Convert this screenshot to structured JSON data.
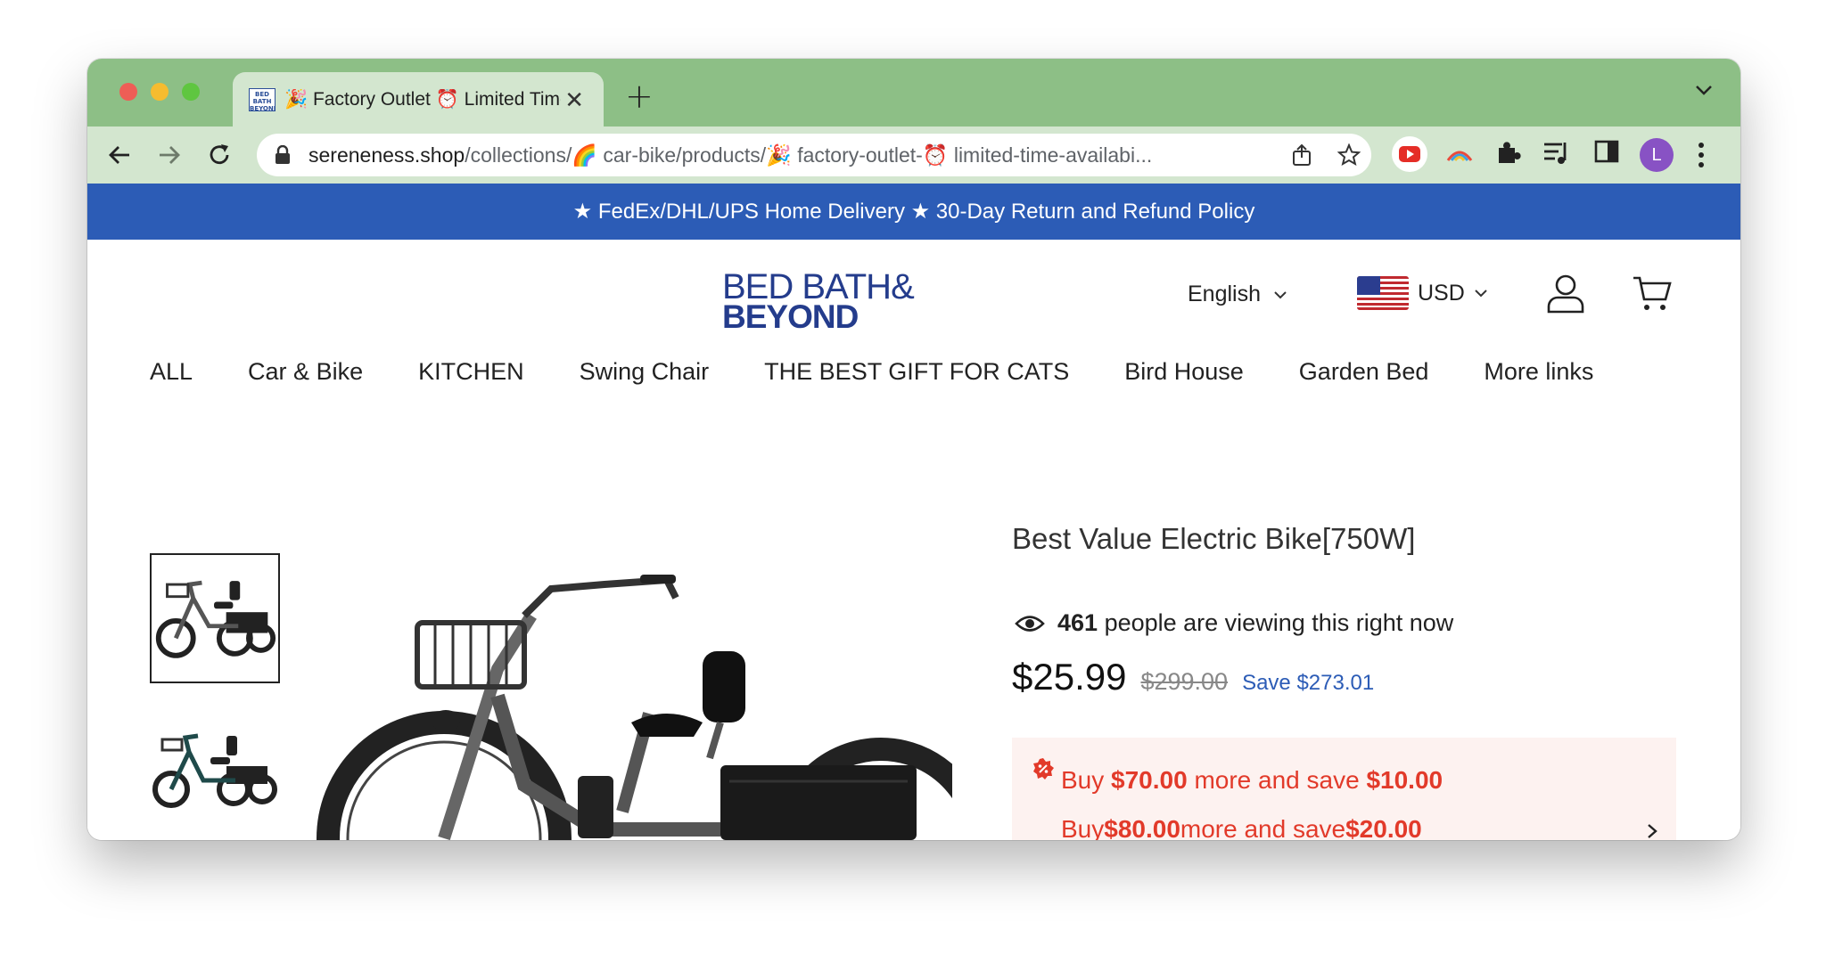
{
  "browser": {
    "tab_title": "🎉 Factory Outlet ⏰ Limited Time Availability",
    "tab_favicon_text": "BED BATH BEYOND",
    "url_host": "sereneness.shop",
    "url_path": "/collections/🌈 car-bike/products/🎉 factory-outlet-⏰ limited-time-availabi...",
    "profile_initial": "L",
    "accent_color": "#8dbf86"
  },
  "announcement": "★ FedEx/DHL/UPS Home Delivery ★ 30-Day Return and Refund Policy",
  "header": {
    "logo_line1": "BED BATH&",
    "logo_line2": "BEYOND",
    "language": "English",
    "currency": "USD"
  },
  "menu": [
    "ALL",
    "Car & Bike",
    "KITCHEN",
    "Swing Chair",
    "THE BEST GIFT FOR CATS",
    "Bird House",
    "Garden Bed",
    "More links"
  ],
  "product": {
    "title": "Best Value Electric Bike[750W]",
    "viewers_count": "461",
    "viewers_text": "people are viewing this right now",
    "price": "$25.99",
    "compare_price": "$299.00",
    "save_text": "Save $273.01"
  },
  "promo": {
    "line1_a": "Buy ",
    "line1_amount": "$70.00",
    "line1_b": " more and save ",
    "line1_save": "$10.00",
    "line2_a": "Buy",
    "line2_amount": "$80.00",
    "line2_b": "more and save",
    "line2_save": "$20.00"
  }
}
